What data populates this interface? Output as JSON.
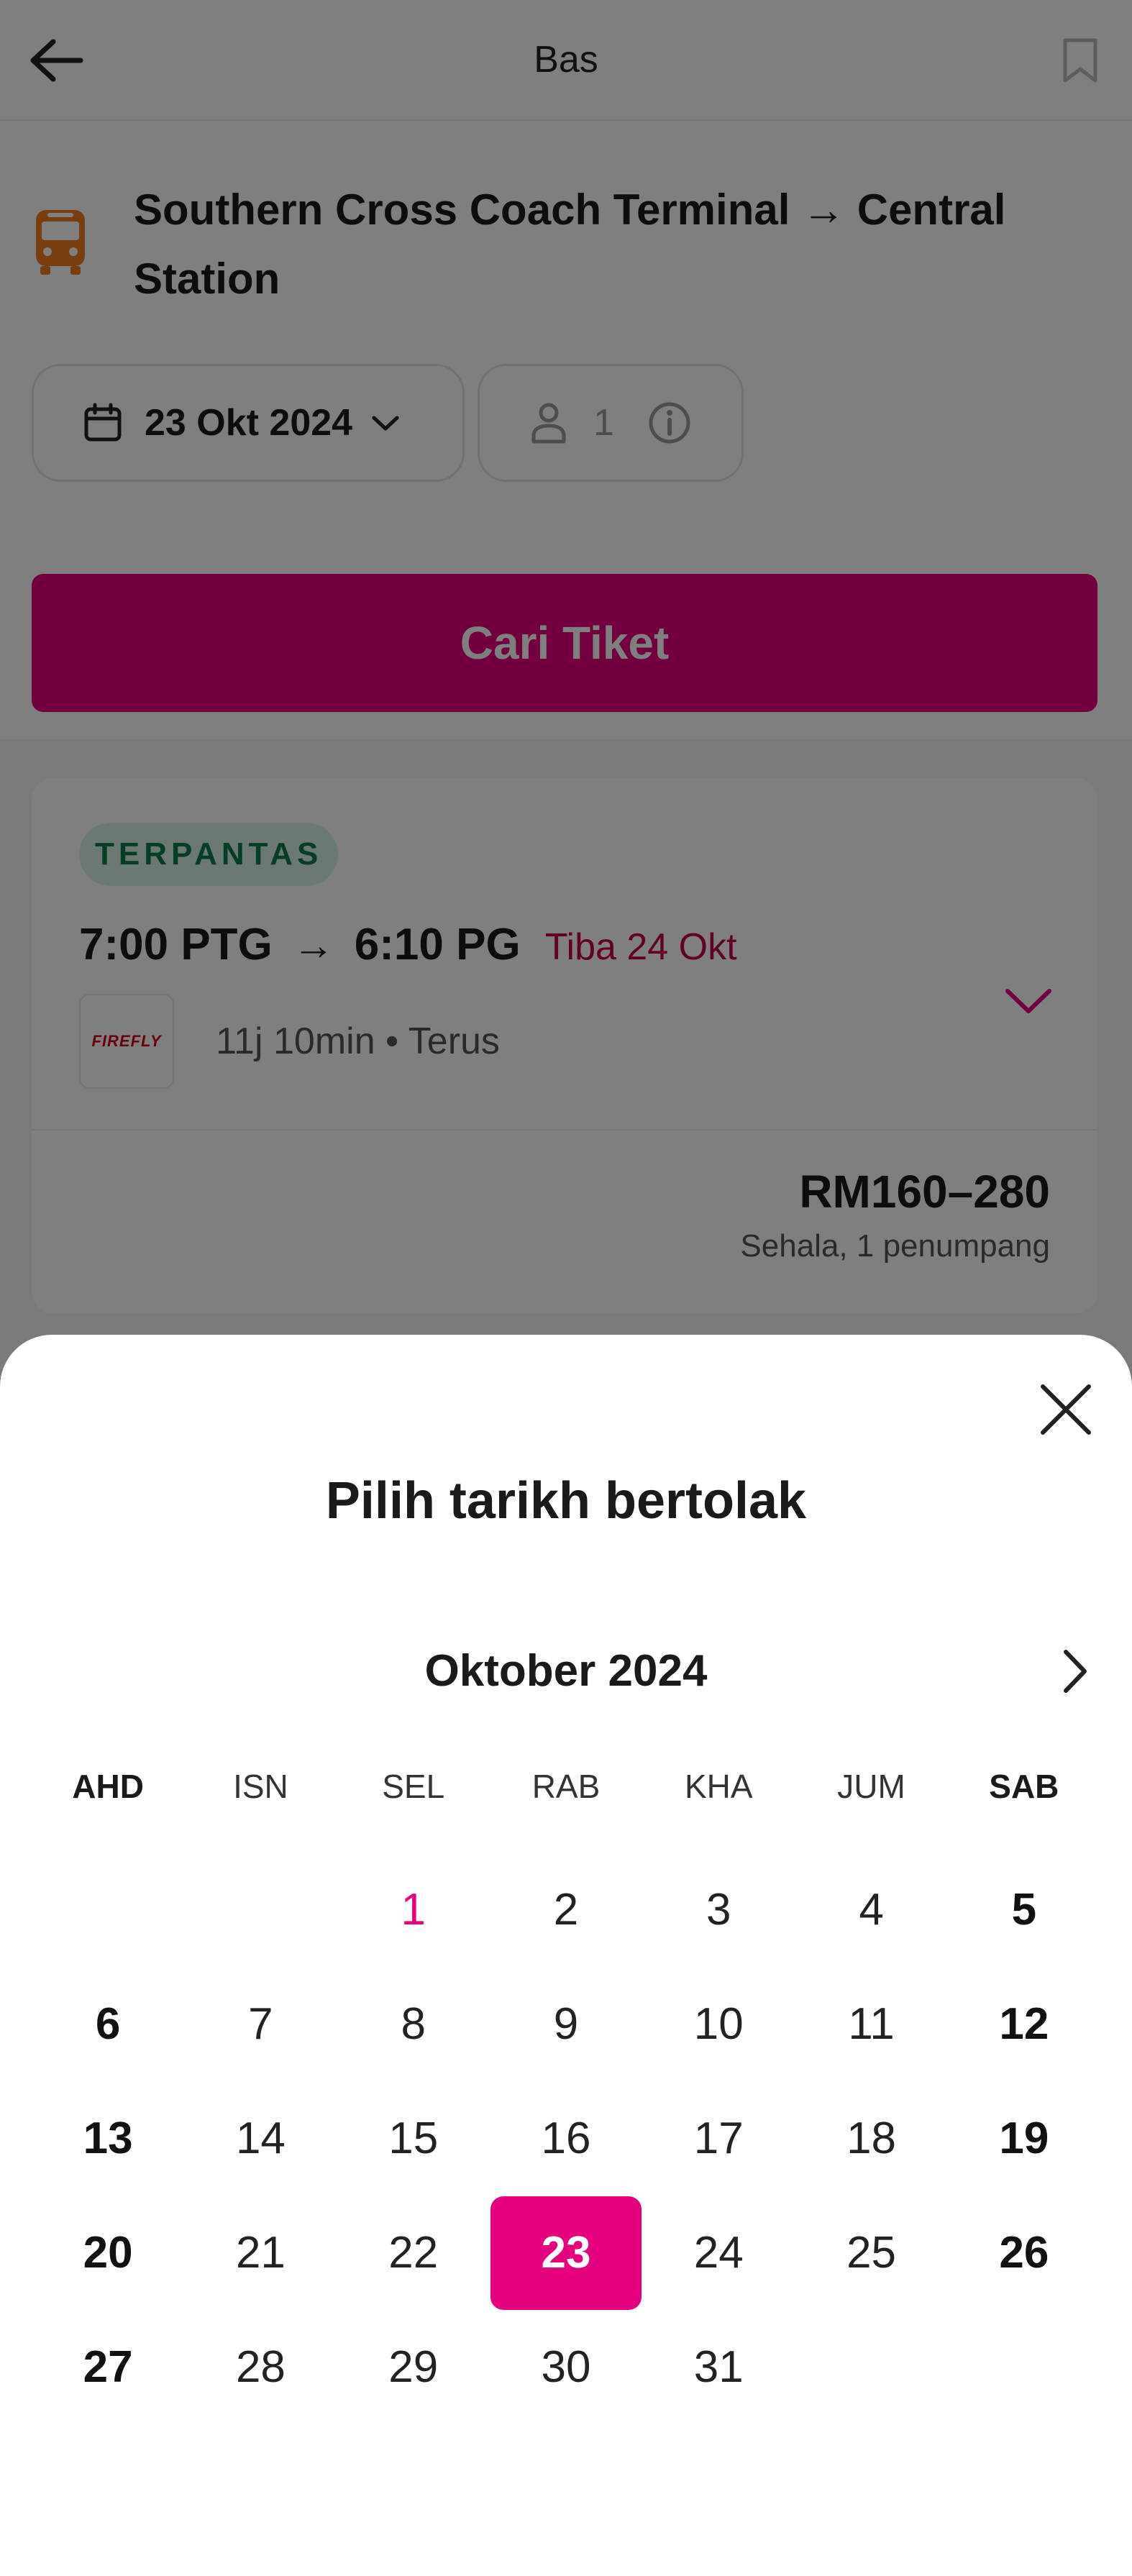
{
  "header": {
    "title": "Bas"
  },
  "search": {
    "route": "Southern Cross Coach Terminal → Central Station",
    "date_label": "23 Okt 2024",
    "passenger_count": "1",
    "search_button": "Cari Tiket"
  },
  "result": {
    "badge": "TERPANTAS",
    "depart_time": "7:00 PTG",
    "arrow": "→",
    "arrive_time": "6:10 PG",
    "arrive_note": "Tiba 24 Okt",
    "operator_logo_text": "FIREFLY",
    "duration": "11j 10min • Terus",
    "price": "RM160–280",
    "price_note": "Sehala, 1 penumpang"
  },
  "calendar": {
    "heading": "Pilih tarikh bertolak",
    "month": "Oktober 2024",
    "weekdays": [
      "AHD",
      "ISN",
      "SEL",
      "RAB",
      "KHA",
      "JUM",
      "SAB"
    ],
    "days": [
      "",
      "",
      "1",
      "2",
      "3",
      "4",
      "5",
      "6",
      "7",
      "8",
      "9",
      "10",
      "11",
      "12",
      "13",
      "14",
      "15",
      "16",
      "17",
      "18",
      "19",
      "20",
      "21",
      "22",
      "23",
      "24",
      "25",
      "26",
      "27",
      "28",
      "29",
      "30",
      "31",
      "",
      ""
    ],
    "today": "1",
    "selected": "23"
  },
  "colors": {
    "accent": "#e5007e",
    "badge_bg": "#d9f2e6",
    "badge_text": "#0c7a4a",
    "arrive_note": "#c4004c",
    "bus_icon": "#f07c1e"
  },
  "icons": {
    "back": "arrow-left-icon",
    "bookmark": "bookmark-icon",
    "bus": "bus-icon",
    "calendar": "calendar-icon",
    "chevron": "chevron-down-icon",
    "person": "person-icon",
    "info": "info-icon",
    "close": "close-icon",
    "next": "chevron-right-icon"
  }
}
